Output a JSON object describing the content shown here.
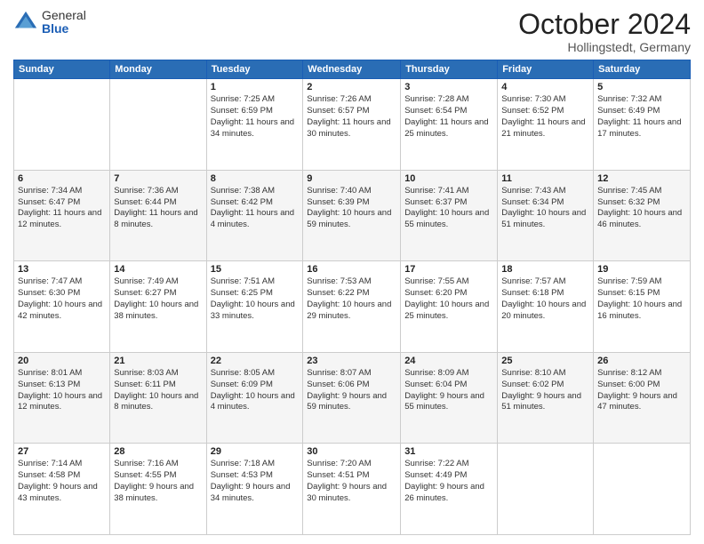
{
  "header": {
    "logo_general": "General",
    "logo_blue": "Blue",
    "month": "October 2024",
    "location": "Hollingstedt, Germany"
  },
  "days_of_week": [
    "Sunday",
    "Monday",
    "Tuesday",
    "Wednesday",
    "Thursday",
    "Friday",
    "Saturday"
  ],
  "weeks": [
    [
      {
        "num": "",
        "sunrise": "",
        "sunset": "",
        "daylight": ""
      },
      {
        "num": "",
        "sunrise": "",
        "sunset": "",
        "daylight": ""
      },
      {
        "num": "1",
        "sunrise": "Sunrise: 7:25 AM",
        "sunset": "Sunset: 6:59 PM",
        "daylight": "Daylight: 11 hours and 34 minutes."
      },
      {
        "num": "2",
        "sunrise": "Sunrise: 7:26 AM",
        "sunset": "Sunset: 6:57 PM",
        "daylight": "Daylight: 11 hours and 30 minutes."
      },
      {
        "num": "3",
        "sunrise": "Sunrise: 7:28 AM",
        "sunset": "Sunset: 6:54 PM",
        "daylight": "Daylight: 11 hours and 25 minutes."
      },
      {
        "num": "4",
        "sunrise": "Sunrise: 7:30 AM",
        "sunset": "Sunset: 6:52 PM",
        "daylight": "Daylight: 11 hours and 21 minutes."
      },
      {
        "num": "5",
        "sunrise": "Sunrise: 7:32 AM",
        "sunset": "Sunset: 6:49 PM",
        "daylight": "Daylight: 11 hours and 17 minutes."
      }
    ],
    [
      {
        "num": "6",
        "sunrise": "Sunrise: 7:34 AM",
        "sunset": "Sunset: 6:47 PM",
        "daylight": "Daylight: 11 hours and 12 minutes."
      },
      {
        "num": "7",
        "sunrise": "Sunrise: 7:36 AM",
        "sunset": "Sunset: 6:44 PM",
        "daylight": "Daylight: 11 hours and 8 minutes."
      },
      {
        "num": "8",
        "sunrise": "Sunrise: 7:38 AM",
        "sunset": "Sunset: 6:42 PM",
        "daylight": "Daylight: 11 hours and 4 minutes."
      },
      {
        "num": "9",
        "sunrise": "Sunrise: 7:40 AM",
        "sunset": "Sunset: 6:39 PM",
        "daylight": "Daylight: 10 hours and 59 minutes."
      },
      {
        "num": "10",
        "sunrise": "Sunrise: 7:41 AM",
        "sunset": "Sunset: 6:37 PM",
        "daylight": "Daylight: 10 hours and 55 minutes."
      },
      {
        "num": "11",
        "sunrise": "Sunrise: 7:43 AM",
        "sunset": "Sunset: 6:34 PM",
        "daylight": "Daylight: 10 hours and 51 minutes."
      },
      {
        "num": "12",
        "sunrise": "Sunrise: 7:45 AM",
        "sunset": "Sunset: 6:32 PM",
        "daylight": "Daylight: 10 hours and 46 minutes."
      }
    ],
    [
      {
        "num": "13",
        "sunrise": "Sunrise: 7:47 AM",
        "sunset": "Sunset: 6:30 PM",
        "daylight": "Daylight: 10 hours and 42 minutes."
      },
      {
        "num": "14",
        "sunrise": "Sunrise: 7:49 AM",
        "sunset": "Sunset: 6:27 PM",
        "daylight": "Daylight: 10 hours and 38 minutes."
      },
      {
        "num": "15",
        "sunrise": "Sunrise: 7:51 AM",
        "sunset": "Sunset: 6:25 PM",
        "daylight": "Daylight: 10 hours and 33 minutes."
      },
      {
        "num": "16",
        "sunrise": "Sunrise: 7:53 AM",
        "sunset": "Sunset: 6:22 PM",
        "daylight": "Daylight: 10 hours and 29 minutes."
      },
      {
        "num": "17",
        "sunrise": "Sunrise: 7:55 AM",
        "sunset": "Sunset: 6:20 PM",
        "daylight": "Daylight: 10 hours and 25 minutes."
      },
      {
        "num": "18",
        "sunrise": "Sunrise: 7:57 AM",
        "sunset": "Sunset: 6:18 PM",
        "daylight": "Daylight: 10 hours and 20 minutes."
      },
      {
        "num": "19",
        "sunrise": "Sunrise: 7:59 AM",
        "sunset": "Sunset: 6:15 PM",
        "daylight": "Daylight: 10 hours and 16 minutes."
      }
    ],
    [
      {
        "num": "20",
        "sunrise": "Sunrise: 8:01 AM",
        "sunset": "Sunset: 6:13 PM",
        "daylight": "Daylight: 10 hours and 12 minutes."
      },
      {
        "num": "21",
        "sunrise": "Sunrise: 8:03 AM",
        "sunset": "Sunset: 6:11 PM",
        "daylight": "Daylight: 10 hours and 8 minutes."
      },
      {
        "num": "22",
        "sunrise": "Sunrise: 8:05 AM",
        "sunset": "Sunset: 6:09 PM",
        "daylight": "Daylight: 10 hours and 4 minutes."
      },
      {
        "num": "23",
        "sunrise": "Sunrise: 8:07 AM",
        "sunset": "Sunset: 6:06 PM",
        "daylight": "Daylight: 9 hours and 59 minutes."
      },
      {
        "num": "24",
        "sunrise": "Sunrise: 8:09 AM",
        "sunset": "Sunset: 6:04 PM",
        "daylight": "Daylight: 9 hours and 55 minutes."
      },
      {
        "num": "25",
        "sunrise": "Sunrise: 8:10 AM",
        "sunset": "Sunset: 6:02 PM",
        "daylight": "Daylight: 9 hours and 51 minutes."
      },
      {
        "num": "26",
        "sunrise": "Sunrise: 8:12 AM",
        "sunset": "Sunset: 6:00 PM",
        "daylight": "Daylight: 9 hours and 47 minutes."
      }
    ],
    [
      {
        "num": "27",
        "sunrise": "Sunrise: 7:14 AM",
        "sunset": "Sunset: 4:58 PM",
        "daylight": "Daylight: 9 hours and 43 minutes."
      },
      {
        "num": "28",
        "sunrise": "Sunrise: 7:16 AM",
        "sunset": "Sunset: 4:55 PM",
        "daylight": "Daylight: 9 hours and 38 minutes."
      },
      {
        "num": "29",
        "sunrise": "Sunrise: 7:18 AM",
        "sunset": "Sunset: 4:53 PM",
        "daylight": "Daylight: 9 hours and 34 minutes."
      },
      {
        "num": "30",
        "sunrise": "Sunrise: 7:20 AM",
        "sunset": "Sunset: 4:51 PM",
        "daylight": "Daylight: 9 hours and 30 minutes."
      },
      {
        "num": "31",
        "sunrise": "Sunrise: 7:22 AM",
        "sunset": "Sunset: 4:49 PM",
        "daylight": "Daylight: 9 hours and 26 minutes."
      },
      {
        "num": "",
        "sunrise": "",
        "sunset": "",
        "daylight": ""
      },
      {
        "num": "",
        "sunrise": "",
        "sunset": "",
        "daylight": ""
      }
    ]
  ]
}
